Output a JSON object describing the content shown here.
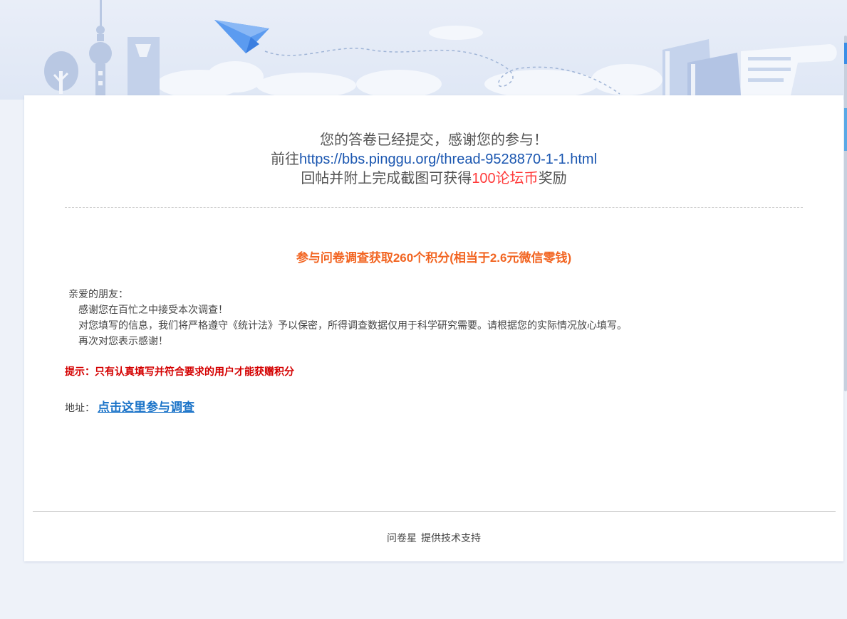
{
  "thanks": {
    "line1": "您的答卷已经提交，感谢您的参与！",
    "line2_prefix": "前往",
    "line2_link": "https://bbs.pinggu.org/thread-9528870-1-1.html",
    "line3_prefix": "回帖并附上完成截图可获得",
    "line3_highlight": "100论坛币",
    "line3_suffix": "奖励"
  },
  "promo": {
    "title": "参与问卷调查获取260个积分(相当于2.6元微信零钱)"
  },
  "letter": {
    "greeting": "亲爱的朋友：",
    "line1": "感谢您在百忙之中接受本次调查！",
    "line2": "对您填写的信息，我们将严格遵守《统计法》予以保密，所得调查数据仅用于科学研究需要。请根据您的实际情况放心填写。",
    "line3": "再次对您表示感谢！"
  },
  "tip": "提示：只有认真填写并符合要求的用户才能获赠积分",
  "address": {
    "label": "地址：",
    "link": "点击这里参与调查"
  },
  "footer": {
    "brand": "问卷星",
    "text": "提供技术支持"
  },
  "colors": {
    "link_blue": "#1a56b0",
    "highlight_red": "#ff3b3b",
    "promo_orange": "#f26522",
    "tip_red": "#d40000",
    "accent_blue": "#1a73c8"
  },
  "icons": [
    "tree-icon",
    "tv-tower-icon",
    "skyscraper-icon",
    "paper-plane-icon",
    "books-icon",
    "document-icon"
  ]
}
